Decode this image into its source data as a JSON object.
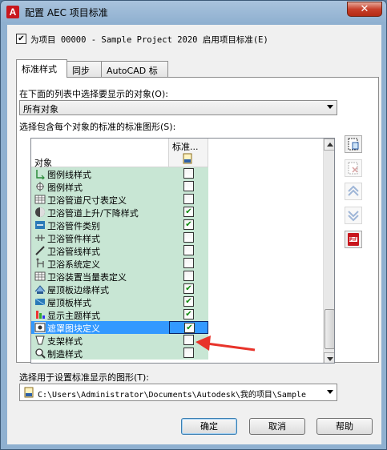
{
  "window": {
    "title": "配置 AEC 项目标准",
    "close_glyph": "✕"
  },
  "apply_checkbox": {
    "label": "为项目 00000 - Sample Project 2020 启用项目标准(E)",
    "checked": true
  },
  "tabs": [
    {
      "label": "标准样式",
      "active": true
    },
    {
      "label": "同步",
      "active": false
    },
    {
      "label": "AutoCAD 标准",
      "active": false
    }
  ],
  "objects_section": {
    "label": "在下面的列表中选择要显示的对象(O):",
    "selected": "所有对象"
  },
  "drawing_section": {
    "label": "选择包含每个对象的标准的标准图形(S):"
  },
  "grid": {
    "col_object": "对象",
    "col_standard": "标准...",
    "rows": [
      {
        "label": "图例线样式",
        "icon": "legend-line-icon",
        "checked": false
      },
      {
        "label": "图例样式",
        "icon": "legend-icon",
        "checked": false
      },
      {
        "label": "卫浴管道尺寸表定义",
        "icon": "table-icon",
        "checked": false
      },
      {
        "label": "卫浴管道上升/下降样式",
        "icon": "rise-drop-icon",
        "checked": true
      },
      {
        "label": "卫浴管件类别",
        "icon": "fitting-category-icon",
        "checked": true
      },
      {
        "label": "卫浴管件样式",
        "icon": "fitting-icon",
        "checked": false
      },
      {
        "label": "卫浴管线样式",
        "icon": "pipe-line-icon",
        "checked": false
      },
      {
        "label": "卫浴系统定义",
        "icon": "system-icon",
        "checked": false
      },
      {
        "label": "卫浴装置当量表定义",
        "icon": "table-icon",
        "checked": false
      },
      {
        "label": "屋顶板边缘样式",
        "icon": "roof-edge-icon",
        "checked": true
      },
      {
        "label": "屋顶板样式",
        "icon": "roof-slab-icon",
        "checked": true
      },
      {
        "label": "显示主题样式",
        "icon": "display-theme-icon",
        "checked": true
      },
      {
        "label": "遮罩图块定义",
        "icon": "mask-block-icon",
        "checked": true,
        "selected": true
      },
      {
        "label": "支架样式",
        "icon": "support-icon",
        "checked": false
      },
      {
        "label": "制造样式",
        "icon": "manufacture-icon",
        "checked": false
      }
    ]
  },
  "side_buttons": [
    {
      "name": "add-drawing-button",
      "icon": "add-file-icon",
      "enabled": true
    },
    {
      "name": "remove-drawing-button",
      "icon": "remove-file-icon",
      "enabled": false
    },
    {
      "name": "move-up-button",
      "icon": "move-up-icon",
      "enabled": false
    },
    {
      "name": "move-down-button",
      "icon": "move-down-icon",
      "enabled": false
    },
    {
      "name": "pdf-button",
      "icon": "pdf-icon",
      "enabled": true
    }
  ],
  "display_section": {
    "label": "选择用于设置标准显示的图形(T):",
    "path": "C:\\Users\\Administrator\\Documents\\Autodesk\\我的项目\\Sample"
  },
  "buttons": {
    "ok": "确定",
    "cancel": "取消",
    "help": "帮助"
  },
  "colors": {
    "accent_selected": "#3399ff",
    "row_tint": "#c8e6d4",
    "check_green": "#0a8a0a",
    "annotation_red": "#e8332a"
  }
}
